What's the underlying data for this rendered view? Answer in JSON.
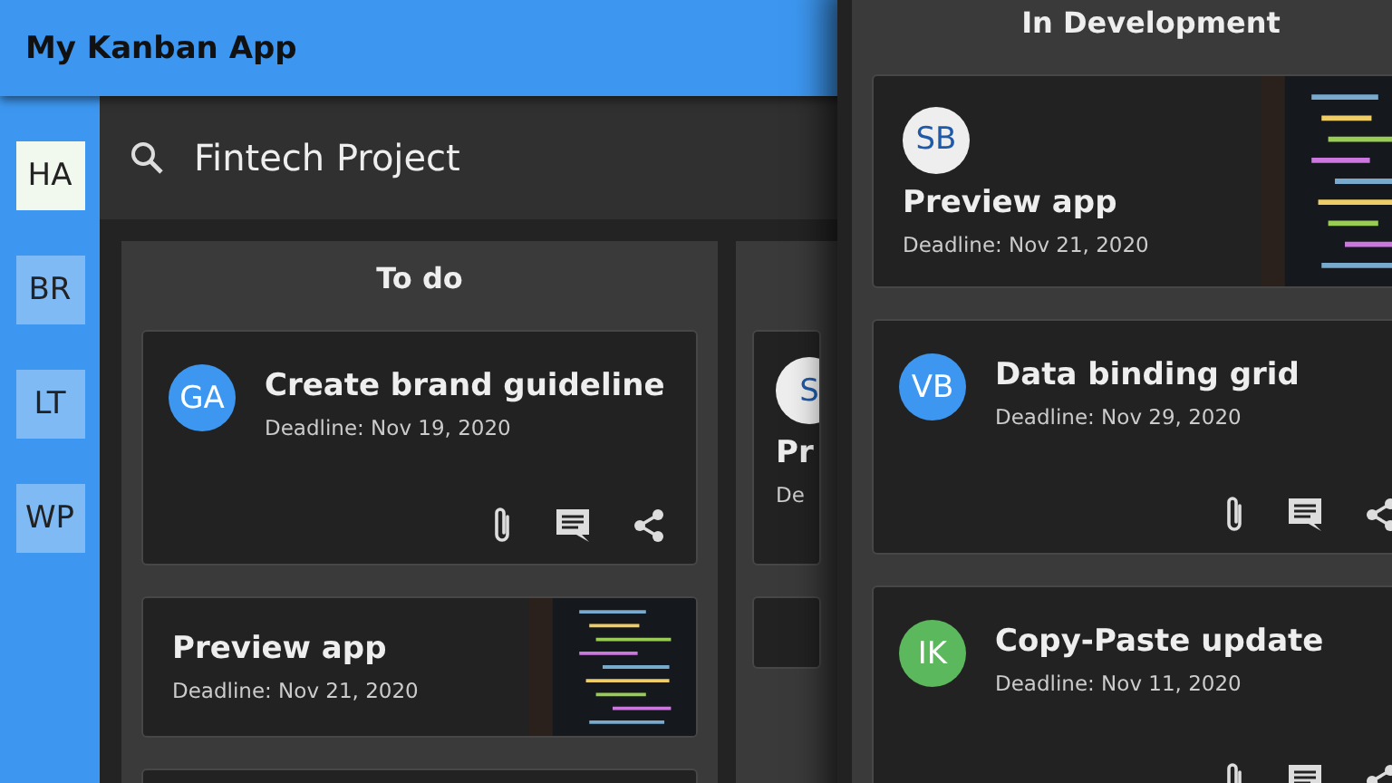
{
  "app_bar": {
    "title": "My Kanban App"
  },
  "sidebar": {
    "items": [
      {
        "label": "HA",
        "selected": true
      },
      {
        "label": "BR",
        "selected": false
      },
      {
        "label": "LT",
        "selected": false
      },
      {
        "label": "WP",
        "selected": false
      }
    ]
  },
  "search": {
    "value": "Fintech Project"
  },
  "columns": [
    {
      "title": "To do",
      "cards": [
        {
          "kind": "actions",
          "avatar": {
            "initials": "GA",
            "color": "#3d97f0"
          },
          "title": "Create brand guideline",
          "deadline": "Deadline: Nov 19, 2020"
        },
        {
          "kind": "image",
          "title": "Preview app",
          "deadline": "Deadline: Nov 21, 2020"
        },
        {
          "kind": "blank"
        }
      ]
    },
    {
      "cards": [
        {
          "kind": "partial",
          "avatar": {
            "initials": "S",
            "color": "#eeeeee"
          },
          "title": "Pr",
          "deadline": "De"
        },
        {
          "kind": "blank"
        }
      ]
    }
  ],
  "floating_column": {
    "title": "In Development",
    "cards": [
      {
        "kind": "image",
        "avatar": {
          "initials": "SB",
          "color": "#eeeeee"
        },
        "title": "Preview app",
        "deadline": "Deadline: Nov 21, 2020"
      },
      {
        "kind": "actions",
        "avatar": {
          "initials": "VB",
          "color": "#3d97f0"
        },
        "title": "Data binding grid",
        "deadline": "Deadline: Nov 29, 2020"
      },
      {
        "kind": "actions",
        "avatar": {
          "initials": "IK",
          "color": "#5cb85c"
        },
        "title": "Copy-Paste update",
        "deadline": "Deadline: Nov 11, 2020"
      }
    ]
  }
}
